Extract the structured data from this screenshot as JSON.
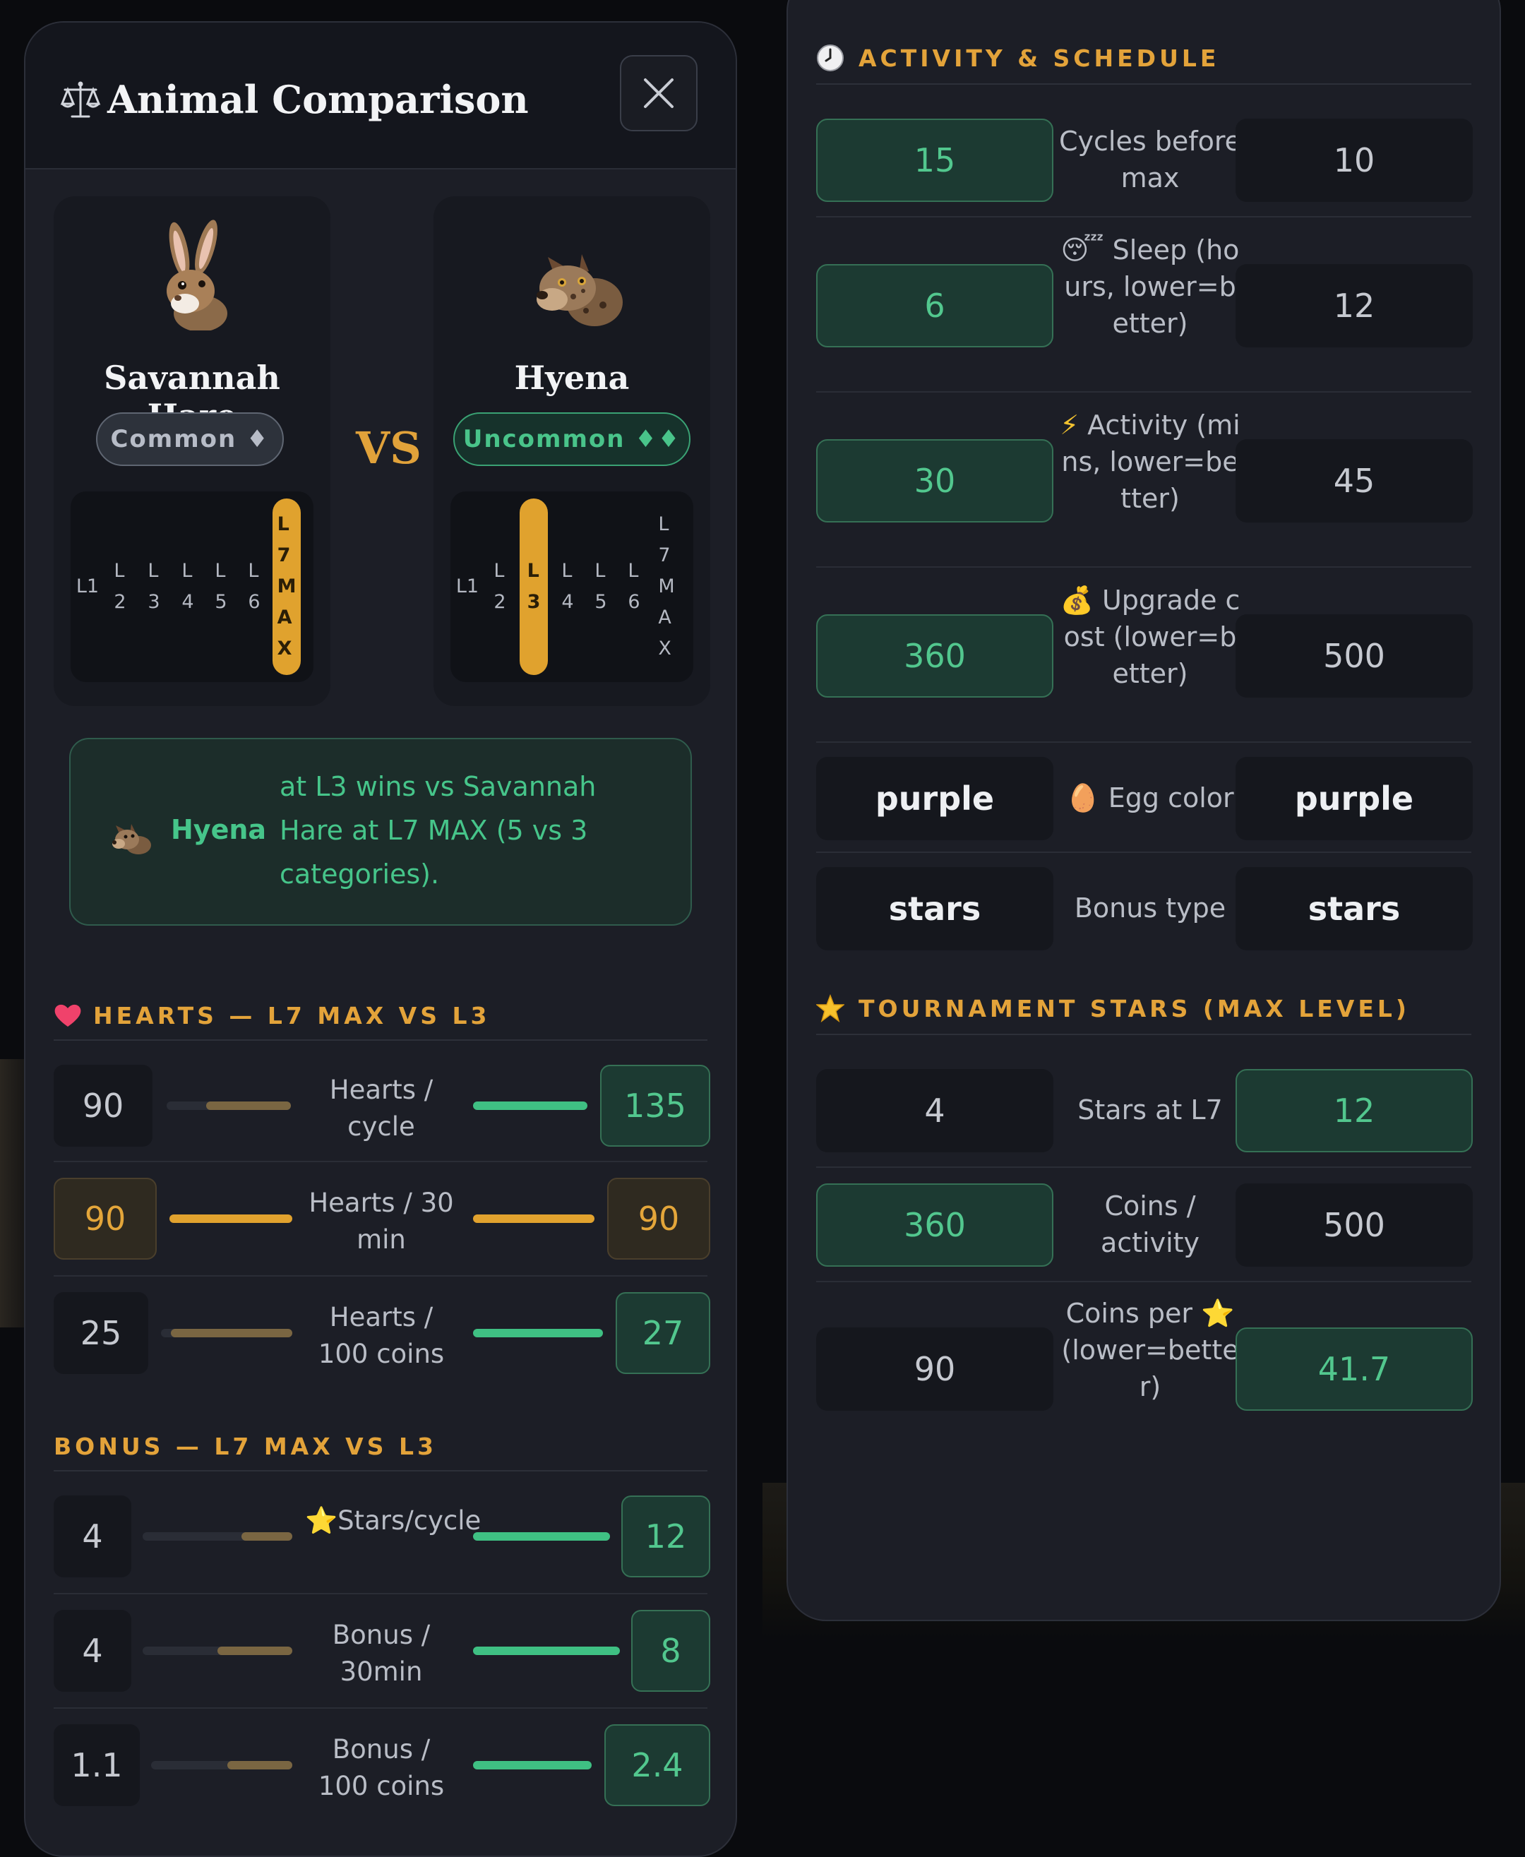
{
  "modal": {
    "title": "Animal Comparison",
    "title_icon": "balance-scale-icon",
    "close_icon": "close-icon",
    "vs_label": "VS"
  },
  "animal_a": {
    "name": "Savannah Hare",
    "rarity": "Common ♦",
    "levels": [
      "L1",
      "L\n2",
      "L\n3",
      "L\n4",
      "L\n5",
      "L\n6",
      "L\n7\nM\nA\nX"
    ],
    "selected_level": "L7 MAX"
  },
  "animal_b": {
    "name": "Hyena",
    "rarity": "Uncommon ♦♦",
    "levels": [
      "L1",
      "L\n2",
      "L\n3",
      "L\n4",
      "L\n5",
      "L\n6",
      "L\n7\nM\nA\nX"
    ],
    "selected_level": "L3"
  },
  "verdict": {
    "winner": "Hyena",
    "text": "at L3 wins vs Savannah Hare at L7 MAX (5 vs 3 categories)."
  },
  "hearts_section": {
    "icon": "heart-icon",
    "title": "HEARTS — L7 MAX VS L3",
    "rows": [
      {
        "label": "Hearts / cycle",
        "a": "90",
        "b": "135",
        "a_fill": 0.6,
        "b_fill": 1.0,
        "result": "b"
      },
      {
        "label": "Hearts / 30 min",
        "a": "90",
        "b": "90",
        "a_fill": 1.0,
        "b_fill": 1.0,
        "result": "tie"
      },
      {
        "label": "Hearts / 100 coins",
        "a": "25",
        "b": "27",
        "a_fill": 0.92,
        "b_fill": 1.0,
        "result": "b"
      }
    ]
  },
  "bonus_section": {
    "title": "BONUS — L7 MAX VS L3",
    "rows": [
      {
        "label": "⭐Stars/cycle",
        "a": "4",
        "b": "12",
        "a_fill": 0.33,
        "b_fill": 1.0,
        "result": "b"
      },
      {
        "label": "Bonus / 30min",
        "a": "4",
        "b": "8",
        "a_fill": 0.5,
        "b_fill": 1.0,
        "result": "b"
      },
      {
        "label": "Bonus / 100 coins",
        "a": "1.1",
        "b": "2.4",
        "a_fill": 0.46,
        "b_fill": 1.0,
        "result": "b"
      }
    ]
  },
  "activity_section": {
    "icon": "clock-icon",
    "title": "ACTIVITY & SCHEDULE",
    "rows": [
      {
        "icon": "",
        "label": "Cycles before max",
        "a": "15",
        "b": "10",
        "result": "a"
      },
      {
        "icon": "😴",
        "label": "Sleep (hours, lower=better)",
        "a": "6",
        "b": "12",
        "result": "a"
      },
      {
        "icon": "⚡",
        "label": "Activity (mins, lower=better)",
        "a": "30",
        "b": "45",
        "result": "a"
      },
      {
        "icon": "💰",
        "label": "Upgrade cost (lower=better)",
        "a": "360",
        "b": "500",
        "result": "a"
      },
      {
        "icon": "🥚",
        "label": "Egg color",
        "a": "purple",
        "b": "purple",
        "result": "text"
      },
      {
        "icon": "",
        "label": "Bonus type",
        "a": "stars",
        "b": "stars",
        "result": "text"
      }
    ]
  },
  "tournament_section": {
    "icon": "star-icon",
    "title": "TOURNAMENT STARS (MAX LEVEL)",
    "rows": [
      {
        "label": "Stars at L7",
        "a": "4",
        "b": "12",
        "result": "b"
      },
      {
        "label": "Coins / activity",
        "a": "360",
        "b": "500",
        "result": "a"
      },
      {
        "label": "Coins per ⭐ (lower=better)",
        "a": "90",
        "b": "41.7",
        "result": "b"
      }
    ]
  },
  "colors": {
    "accent_gold": "#e3a33a",
    "win_green": "#52c78e",
    "panel_bg": "#1c1e26"
  }
}
